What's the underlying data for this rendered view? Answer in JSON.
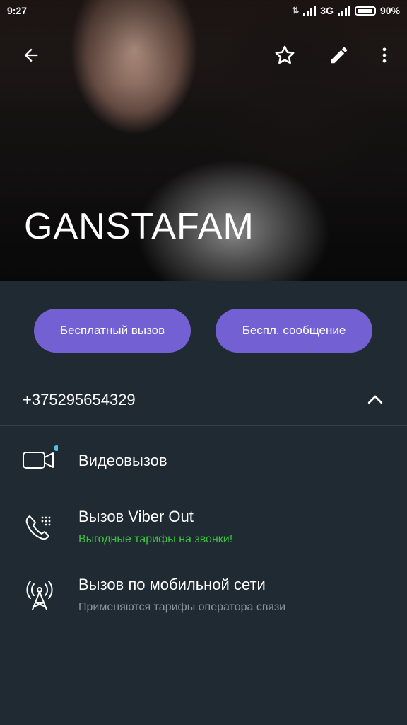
{
  "status_bar": {
    "time": "9:27",
    "network": "3G",
    "battery": "90%"
  },
  "header": {
    "contact_name": "GANSTAFAM"
  },
  "actions": {
    "free_call_label": "Бесплатный вызов",
    "free_message_label": "Беспл. сообщение"
  },
  "phone": {
    "number": "+375295654329"
  },
  "options": [
    {
      "title": "Видеовызов",
      "subtitle": "",
      "icon": "video-camera-icon"
    },
    {
      "title": "Вызов Viber Out",
      "subtitle": "Выгодные тарифы на звонки!",
      "icon": "phone-dialpad-icon"
    },
    {
      "title": "Вызов по мобильной сети",
      "subtitle": "Применяются тарифы оператора связи",
      "icon": "cell-tower-icon"
    }
  ],
  "colors": {
    "accent": "#7360d2",
    "background": "#1f2a33",
    "promo_green": "#3fc13f",
    "subtitle_gray": "#8a949c",
    "notification_dot": "#4fc3e0"
  }
}
